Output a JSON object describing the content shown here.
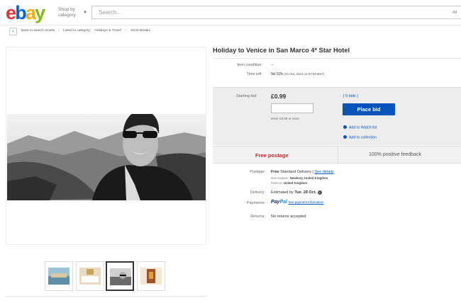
{
  "header": {
    "logo": [
      "e",
      "b",
      "a",
      "y"
    ],
    "shop_by": "Shop by category",
    "search_placeholder": "Search...",
    "all_categories": "Al"
  },
  "breadcrumb": {
    "back": "Back to search results",
    "listed_in": "Listed in category:",
    "category": "Holidays & Travel",
    "subcategory": "Short Breaks"
  },
  "item": {
    "title": "Holiday to Venice in San Marco 4* Star Hotel",
    "condition_label": "Item condition:",
    "condition_value": "--",
    "time_left_label": "Time left:",
    "time_left_value": "9d 02h",
    "time_left_end": "(24 Oct, 2014  11:07:50 BST)"
  },
  "bid": {
    "starting_bid_label": "Starting bid:",
    "price": "£0.99",
    "bids_link": "[ 0 bids ]",
    "input_value": "",
    "hint": "Enter £0.99 or more",
    "place_bid": "Place bid",
    "watch_list": "Add to Watch list",
    "collection": "Add to collection"
  },
  "postage_bar": {
    "free_postage": "Free postage",
    "feedback": "100% positive feedback"
  },
  "details": {
    "postage_label": "Postage:",
    "postage_value": "Free",
    "postage_service": "Standard Delivery |",
    "see_details": "See details",
    "item_location_label": "Item location:",
    "item_location": "Newbury, United Kingdom",
    "posts_to_label": "Posts to:",
    "posts_to": "United Kingdom",
    "delivery_label": "Delivery:",
    "delivery_prefix": "Estimated by",
    "delivery_date": "Tue. 28 Oct.",
    "payments_label": "Payments:",
    "paypal_1": "Pay",
    "paypal_2": "Pal",
    "payment_info": "See payment information",
    "returns_label": "Returns:",
    "returns_value": "No returns accepted"
  },
  "thumbnails": [
    "harbour-thumb",
    "hotel-room-thumb",
    "selfie-thumb",
    "interior-thumb"
  ],
  "colors": {
    "ebay_red": "#e53238",
    "ebay_blue": "#0064d2",
    "ebay_yellow": "#f5af02",
    "ebay_green": "#86b817",
    "link_blue": "#0654ba",
    "free_postage_red": "#c02b2b"
  }
}
